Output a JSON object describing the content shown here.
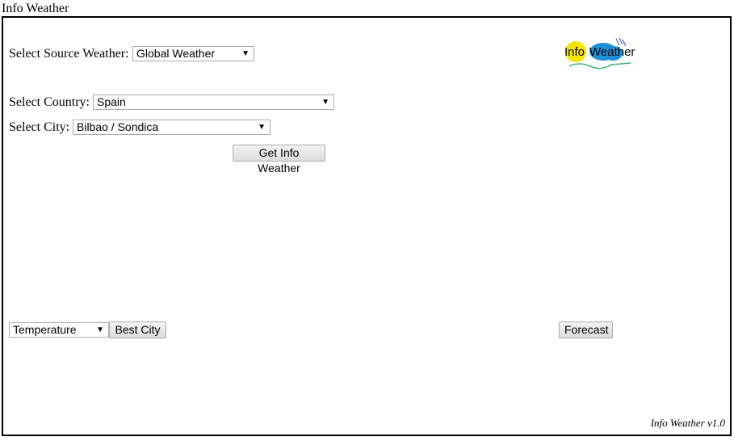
{
  "page": {
    "title": "Info Weather"
  },
  "source": {
    "label": "Select Source Weather:",
    "selected": "Global Weather"
  },
  "country": {
    "label": "Select Country:",
    "selected": "Spain"
  },
  "city": {
    "label": "Select City:",
    "selected": "Bilbao / Sondica"
  },
  "actions": {
    "get_info_label": "Get Info Weather",
    "best_city_label": "Best City",
    "forecast_label": "Forecast"
  },
  "metric": {
    "selected": "Temperature"
  },
  "logo": {
    "text_info": "Info",
    "text_weather": "Weather",
    "sun_color": "#f5e600",
    "cloud_color": "#1e90d6",
    "rain_color": "#4a5fc1",
    "grass_color": "#3cb371"
  },
  "footer": {
    "version": "Info Weather v1.0"
  },
  "icons": {
    "dropdown": "caret-down-icon"
  }
}
